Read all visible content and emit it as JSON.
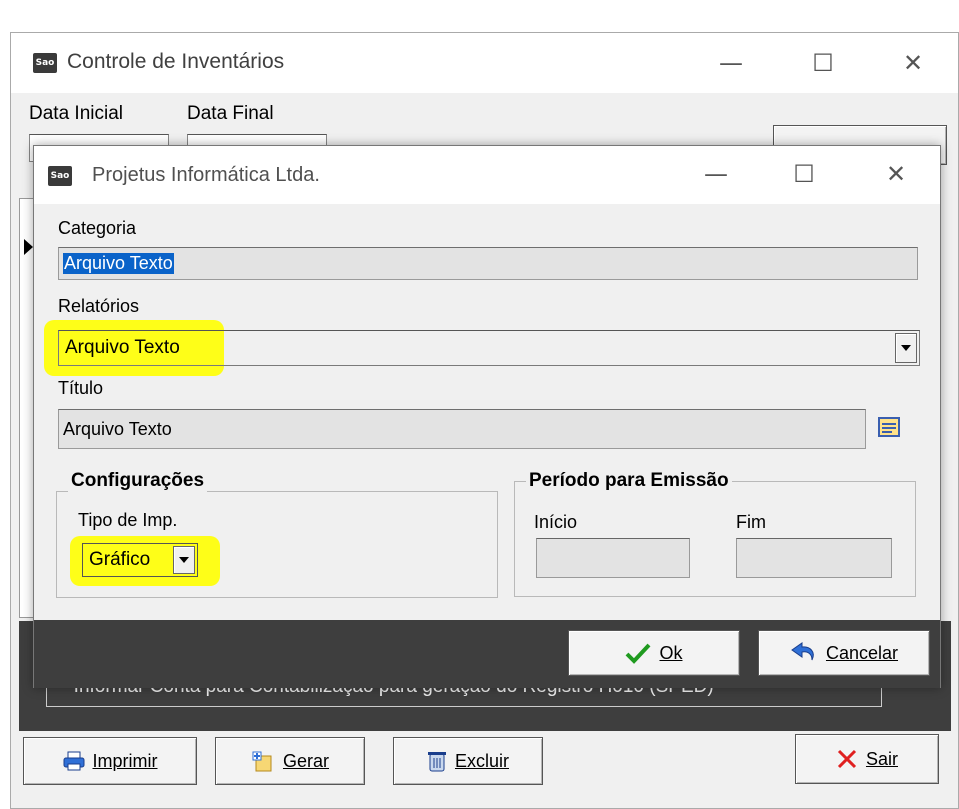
{
  "main_window": {
    "title": "Controle de Inventários",
    "app_icon_text": "Sao",
    "data_inicial_label": "Data Inicial",
    "data_final_label": "Data Final",
    "info_text": "* Informar Conta para Contabilização para geração do Registro H010 (SPED)",
    "buttons": {
      "imprimir": "Imprimir",
      "gerar": "Gerar",
      "excluir": "Excluir",
      "sair": "Sair"
    }
  },
  "dialog": {
    "title": "Projetus Informática Ltda.",
    "app_icon_text": "Sao",
    "categoria_label": "Categoria",
    "categoria_value": "Arquivo Texto",
    "relatorios_label": "Relatórios",
    "relatorios_value": "Arquivo Texto",
    "titulo_label": "Título",
    "titulo_value": "Arquivo Texto",
    "configuracoes_title": "Configurações",
    "tipo_imp_label": "Tipo de Imp.",
    "tipo_imp_value": "Gráfico",
    "periodo_title": "Período para Emissão",
    "inicio_label": "Início",
    "fim_label": "Fim",
    "ok_label": "Ok",
    "cancelar_label": "Cancelar"
  },
  "colors": {
    "highlight": "#ffff00",
    "selection": "#0a63c9",
    "dark_panel": "#3e3e3e"
  }
}
